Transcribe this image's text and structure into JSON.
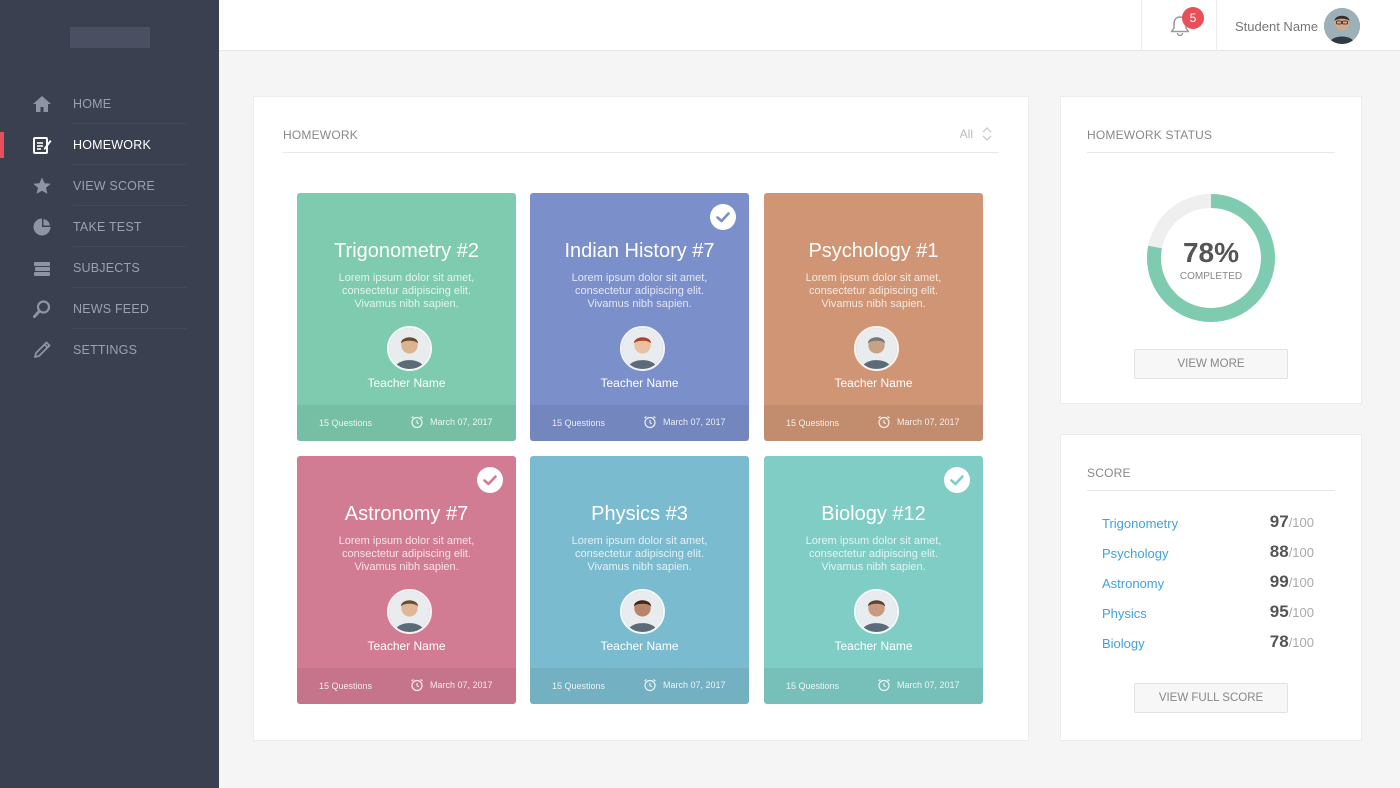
{
  "sidebar": {
    "items": [
      {
        "label": "HOME",
        "icon": "home-icon"
      },
      {
        "label": "HOMEWORK",
        "icon": "homework-icon",
        "active": true
      },
      {
        "label": "VIEW SCORE",
        "icon": "star-icon"
      },
      {
        "label": "TAKE TEST",
        "icon": "pie-icon"
      },
      {
        "label": "SUBJECTS",
        "icon": "books-icon"
      },
      {
        "label": "NEWS FEED",
        "icon": "search-icon"
      },
      {
        "label": "SETTINGS",
        "icon": "pencil-icon"
      }
    ]
  },
  "topbar": {
    "notification_count": "5",
    "student_name": "Student Name"
  },
  "homework": {
    "title": "HOMEWORK",
    "filter": "All",
    "cards": [
      {
        "title": "Trigonometry #2",
        "desc": "Lorem ipsum dolor sit amet, consectetur adipiscing elit. Vivamus nibh sapien.",
        "teacher": "Teacher Name",
        "questions": "15 Questions",
        "date": "March 07, 2017",
        "color": "#7ecbb0",
        "done": false
      },
      {
        "title": "Indian History #7",
        "desc": "Lorem ipsum dolor sit amet, consectetur adipiscing elit. Vivamus nibh sapien.",
        "teacher": "Teacher Name",
        "questions": "15 Questions",
        "date": "March 07, 2017",
        "color": "#7b8fca",
        "done": true
      },
      {
        "title": "Psychology #1",
        "desc": "Lorem ipsum dolor sit amet, consectetur adipiscing elit. Vivamus nibh sapien.",
        "teacher": "Teacher Name",
        "questions": "15 Questions",
        "date": "March 07, 2017",
        "color": "#cf9575",
        "done": false
      },
      {
        "title": "Astronomy #7",
        "desc": "Lorem ipsum dolor sit amet, consectetur adipiscing elit. Vivamus nibh sapien.",
        "teacher": "Teacher Name",
        "questions": "15 Questions",
        "date": "March 07, 2017",
        "color": "#d27c94",
        "done": true
      },
      {
        "title": "Physics #3",
        "desc": "Lorem ipsum dolor sit amet, consectetur adipiscing elit. Vivamus nibh sapien.",
        "teacher": "Teacher Name",
        "questions": "15 Questions",
        "date": "March 07, 2017",
        "color": "#7bbbcf",
        "done": false
      },
      {
        "title": "Biology #12",
        "desc": "Lorem ipsum dolor sit amet, consectetur adipiscing elit. Vivamus nibh sapien.",
        "teacher": "Teacher Name",
        "questions": "15 Questions",
        "date": "March 07, 2017",
        "color": "#7fcdc5",
        "done": true
      }
    ]
  },
  "status": {
    "title": "HOMEWORK STATUS",
    "percent": "78%",
    "percent_value": 0.78,
    "label": "COMPLETED",
    "button": "VIEW MORE",
    "accent": "#7ecbb0"
  },
  "score": {
    "title": "SCORE",
    "rows": [
      {
        "subject": "Trigonometry",
        "value": "97",
        "max": "/100"
      },
      {
        "subject": "Psychology",
        "value": "88",
        "max": "/100"
      },
      {
        "subject": "Astronomy",
        "value": "99",
        "max": "/100"
      },
      {
        "subject": "Physics",
        "value": "95",
        "max": "/100"
      },
      {
        "subject": "Biology",
        "value": "78",
        "max": "/100"
      }
    ],
    "button": "VIEW FULL SCORE"
  }
}
